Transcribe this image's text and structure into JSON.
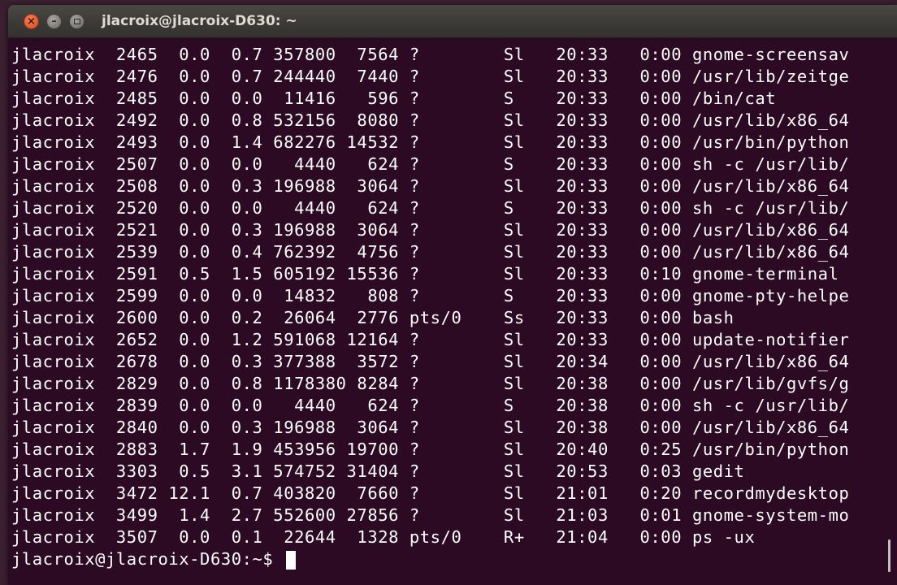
{
  "window": {
    "title": "jlacroix@jlacroix-D630: ~",
    "close_symbol": "×",
    "minimize_symbol": "–",
    "colors": {
      "background": "#2c0a23",
      "text": "#ffffff",
      "close": "#e05a2c"
    }
  },
  "terminal": {
    "rows": [
      "jlacroix  2465  0.0  0.7 357800  7564 ?        Sl   20:33   0:00 gnome-screensav",
      "jlacroix  2476  0.0  0.7 244440  7440 ?        Sl   20:33   0:00 /usr/lib/zeitge",
      "jlacroix  2485  0.0  0.0  11416   596 ?        S    20:33   0:00 /bin/cat",
      "jlacroix  2492  0.0  0.8 532156  8080 ?        Sl   20:33   0:00 /usr/lib/x86_64",
      "jlacroix  2493  0.0  1.4 682276 14532 ?        Sl   20:33   0:00 /usr/bin/python",
      "jlacroix  2507  0.0  0.0   4440   624 ?        S    20:33   0:00 sh -c /usr/lib/",
      "jlacroix  2508  0.0  0.3 196988  3064 ?        Sl   20:33   0:00 /usr/lib/x86_64",
      "jlacroix  2520  0.0  0.0   4440   624 ?        S    20:33   0:00 sh -c /usr/lib/",
      "jlacroix  2521  0.0  0.3 196988  3064 ?        Sl   20:33   0:00 /usr/lib/x86_64",
      "jlacroix  2539  0.0  0.4 762392  4756 ?        Sl   20:33   0:00 /usr/lib/x86_64",
      "jlacroix  2591  0.5  1.5 605192 15536 ?        Sl   20:33   0:10 gnome-terminal",
      "jlacroix  2599  0.0  0.0  14832   808 ?        S    20:33   0:00 gnome-pty-helpe",
      "jlacroix  2600  0.0  0.2  26064  2776 pts/0    Ss   20:33   0:00 bash",
      "jlacroix  2652  0.0  1.2 591068 12164 ?        Sl   20:33   0:00 update-notifier",
      "jlacroix  2678  0.0  0.3 377388  3572 ?        Sl   20:34   0:00 /usr/lib/x86_64",
      "jlacroix  2829  0.0  0.8 1178380 8284 ?        Sl   20:38   0:00 /usr/lib/gvfs/g",
      "jlacroix  2839  0.0  0.0   4440   624 ?        S    20:38   0:00 sh -c /usr/lib/",
      "jlacroix  2840  0.0  0.3 196988  3064 ?        Sl   20:38   0:00 /usr/lib/x86_64",
      "jlacroix  2883  1.7  1.9 453956 19700 ?        Sl   20:40   0:25 /usr/bin/python",
      "jlacroix  3303  0.5  3.1 574752 31404 ?        Sl   20:53   0:03 gedit",
      "jlacroix  3472 12.1  0.7 403820  7660 ?        Sl   21:01   0:20 recordmydesktop",
      "jlacroix  3499  1.4  2.7 552600 27856 ?        Sl   21:03   0:01 gnome-system-mo",
      "jlacroix  3507  0.0  0.1  22644  1328 pts/0    R+   21:04   0:00 ps -ux"
    ],
    "prompt": "jlacroix@jlacroix-D630:~$ "
  }
}
